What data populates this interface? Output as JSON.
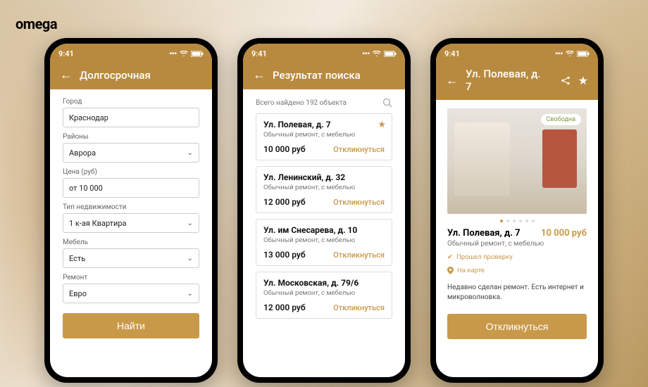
{
  "brand": "omega",
  "status": {
    "time": "9:41"
  },
  "screen1": {
    "title": "Долгосрочная",
    "fields": {
      "city": {
        "label": "Город",
        "value": "Краснодар"
      },
      "district": {
        "label": "Районы",
        "value": "Аврора"
      },
      "price": {
        "label": "Цена (руб)",
        "value": "от 10 000"
      },
      "type": {
        "label": "Тип недвижимости",
        "value": "1 к-ая Квартира"
      },
      "furniture": {
        "label": "Мебель",
        "value": "Есть"
      },
      "renovation": {
        "label": "Ремонт",
        "value": "Евро"
      }
    },
    "submit": "Найти"
  },
  "screen2": {
    "title": "Результат поиска",
    "summary": "Всего найдено 192 объекта",
    "respond_label": "Откликнуться",
    "items": [
      {
        "title": "Ул. Полевая, д. 7",
        "sub": "Обычный ремонт, с мебелью",
        "price": "10 000 руб",
        "starred": true
      },
      {
        "title": "Ул. Ленинский, д. 32",
        "sub": "Обычный ремонт, с мебелью",
        "price": "12 000 руб",
        "starred": false
      },
      {
        "title": "Ул. им Снесарева, д. 10",
        "sub": "Обычный ремонт, с мебелью",
        "price": "13 000 руб",
        "starred": false
      },
      {
        "title": "Ул. Московская, д. 79/6",
        "sub": "Обычный ремонт, с мебелью",
        "price": "12 000 руб",
        "starred": false
      }
    ]
  },
  "screen3": {
    "title": "Ул. Полевая, д. 7",
    "badge": "Свободна",
    "heading": "Ул. Полевая, д. 7",
    "price": "10 000 руб",
    "sub": "Обычный ремонт, с мебелью",
    "verified": "Прошел проверку",
    "map": "На карте",
    "desc": "Недавно сделан ремонт. Есть интернет и микроволновка.",
    "cta": "Откликнуться"
  }
}
